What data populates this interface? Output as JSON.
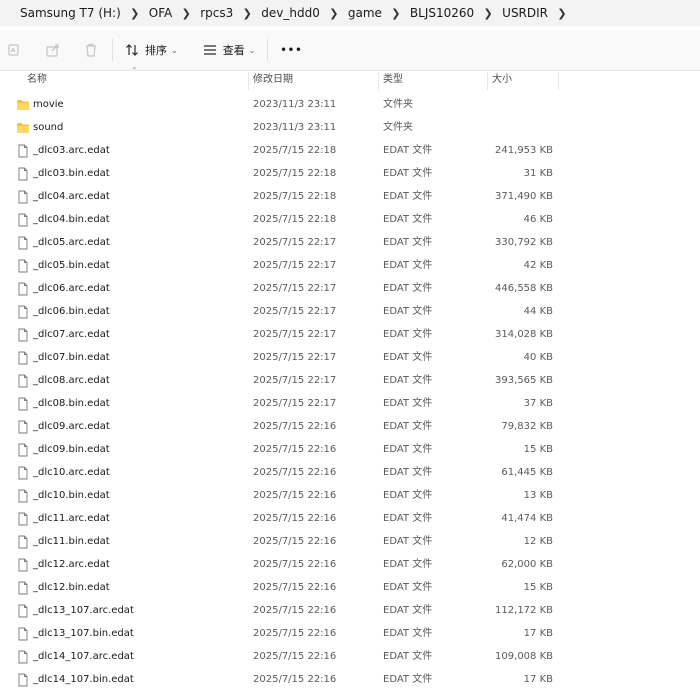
{
  "breadcrumb": [
    "Samsung T7 (H:)",
    "OFA",
    "rpcs3",
    "dev_hdd0",
    "game",
    "BLJS10260",
    "USRDIR"
  ],
  "toolbar": {
    "sort_label": "排序",
    "view_label": "查看",
    "more_label": "•••"
  },
  "columns": {
    "name": "名称",
    "date": "修改日期",
    "type": "类型",
    "size": "大小"
  },
  "files": [
    {
      "name": "movie",
      "date": "2023/11/3 23:11",
      "type": "文件夹",
      "size": "",
      "kind": "folder"
    },
    {
      "name": "sound",
      "date": "2023/11/3 23:11",
      "type": "文件夹",
      "size": "",
      "kind": "folder"
    },
    {
      "name": "_dlc03.arc.edat",
      "date": "2025/7/15 22:18",
      "type": "EDAT 文件",
      "size": "241,953 KB",
      "kind": "file"
    },
    {
      "name": "_dlc03.bin.edat",
      "date": "2025/7/15 22:18",
      "type": "EDAT 文件",
      "size": "31 KB",
      "kind": "file"
    },
    {
      "name": "_dlc04.arc.edat",
      "date": "2025/7/15 22:18",
      "type": "EDAT 文件",
      "size": "371,490 KB",
      "kind": "file"
    },
    {
      "name": "_dlc04.bin.edat",
      "date": "2025/7/15 22:18",
      "type": "EDAT 文件",
      "size": "46 KB",
      "kind": "file"
    },
    {
      "name": "_dlc05.arc.edat",
      "date": "2025/7/15 22:17",
      "type": "EDAT 文件",
      "size": "330,792 KB",
      "kind": "file"
    },
    {
      "name": "_dlc05.bin.edat",
      "date": "2025/7/15 22:17",
      "type": "EDAT 文件",
      "size": "42 KB",
      "kind": "file"
    },
    {
      "name": "_dlc06.arc.edat",
      "date": "2025/7/15 22:17",
      "type": "EDAT 文件",
      "size": "446,558 KB",
      "kind": "file"
    },
    {
      "name": "_dlc06.bin.edat",
      "date": "2025/7/15 22:17",
      "type": "EDAT 文件",
      "size": "44 KB",
      "kind": "file"
    },
    {
      "name": "_dlc07.arc.edat",
      "date": "2025/7/15 22:17",
      "type": "EDAT 文件",
      "size": "314,028 KB",
      "kind": "file"
    },
    {
      "name": "_dlc07.bin.edat",
      "date": "2025/7/15 22:17",
      "type": "EDAT 文件",
      "size": "40 KB",
      "kind": "file"
    },
    {
      "name": "_dlc08.arc.edat",
      "date": "2025/7/15 22:17",
      "type": "EDAT 文件",
      "size": "393,565 KB",
      "kind": "file"
    },
    {
      "name": "_dlc08.bin.edat",
      "date": "2025/7/15 22:17",
      "type": "EDAT 文件",
      "size": "37 KB",
      "kind": "file"
    },
    {
      "name": "_dlc09.arc.edat",
      "date": "2025/7/15 22:16",
      "type": "EDAT 文件",
      "size": "79,832 KB",
      "kind": "file"
    },
    {
      "name": "_dlc09.bin.edat",
      "date": "2025/7/15 22:16",
      "type": "EDAT 文件",
      "size": "15 KB",
      "kind": "file"
    },
    {
      "name": "_dlc10.arc.edat",
      "date": "2025/7/15 22:16",
      "type": "EDAT 文件",
      "size": "61,445 KB",
      "kind": "file"
    },
    {
      "name": "_dlc10.bin.edat",
      "date": "2025/7/15 22:16",
      "type": "EDAT 文件",
      "size": "13 KB",
      "kind": "file"
    },
    {
      "name": "_dlc11.arc.edat",
      "date": "2025/7/15 22:16",
      "type": "EDAT 文件",
      "size": "41,474 KB",
      "kind": "file"
    },
    {
      "name": "_dlc11.bin.edat",
      "date": "2025/7/15 22:16",
      "type": "EDAT 文件",
      "size": "12 KB",
      "kind": "file"
    },
    {
      "name": "_dlc12.arc.edat",
      "date": "2025/7/15 22:16",
      "type": "EDAT 文件",
      "size": "62,000 KB",
      "kind": "file"
    },
    {
      "name": "_dlc12.bin.edat",
      "date": "2025/7/15 22:16",
      "type": "EDAT 文件",
      "size": "15 KB",
      "kind": "file"
    },
    {
      "name": "_dlc13_107.arc.edat",
      "date": "2025/7/15 22:16",
      "type": "EDAT 文件",
      "size": "112,172 KB",
      "kind": "file"
    },
    {
      "name": "_dlc13_107.bin.edat",
      "date": "2025/7/15 22:16",
      "type": "EDAT 文件",
      "size": "17 KB",
      "kind": "file"
    },
    {
      "name": "_dlc14_107.arc.edat",
      "date": "2025/7/15 22:16",
      "type": "EDAT 文件",
      "size": "109,008 KB",
      "kind": "file"
    },
    {
      "name": "_dlc14_107.bin.edat",
      "date": "2025/7/15 22:16",
      "type": "EDAT 文件",
      "size": "17 KB",
      "kind": "file"
    }
  ]
}
